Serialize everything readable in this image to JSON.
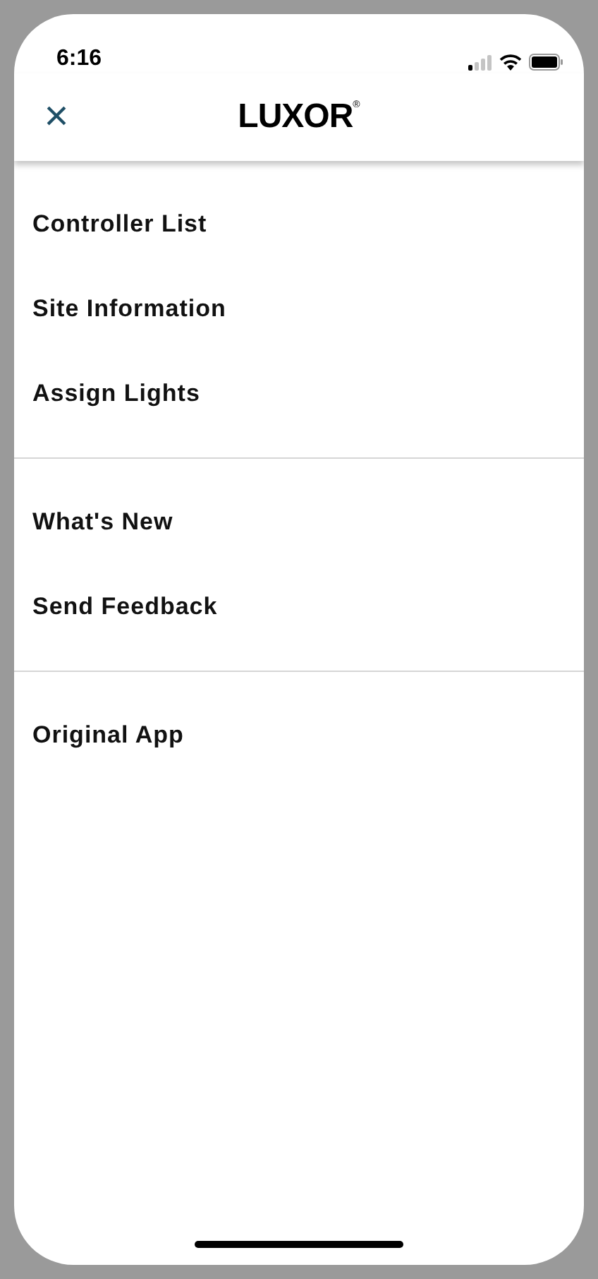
{
  "status_bar": {
    "time": "6:16"
  },
  "header": {
    "close": "×",
    "logo": "LUXOR",
    "logo_mark": "®"
  },
  "menu_sections": [
    {
      "items": [
        "Controller List",
        "Site Information",
        "Assign Lights"
      ]
    },
    {
      "items": [
        "What's New",
        "Send Feedback"
      ]
    },
    {
      "items": [
        "Original App"
      ]
    }
  ]
}
